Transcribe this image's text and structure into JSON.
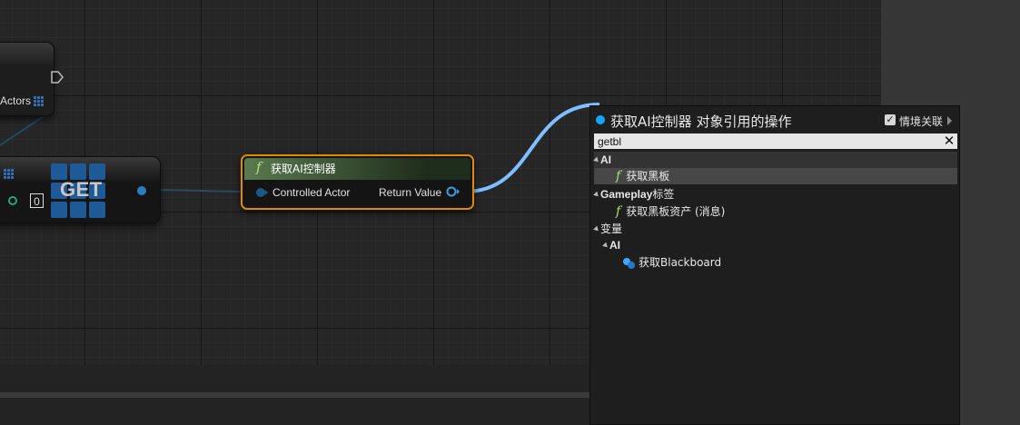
{
  "graph": {
    "top_node": {
      "pin_label": "Actors"
    },
    "get_node": {
      "title": "GET",
      "index_value": "0"
    },
    "ai_node": {
      "title": "获取AI控制器",
      "input_label": "Controlled Actor",
      "output_label": "Return Value",
      "border_color": "#e08a00",
      "header_color": "#5a7a4f"
    },
    "wire_color": "#7fbfff"
  },
  "popup": {
    "title": "获取AI控制器 对象引用的操作",
    "context_label": "情境关联",
    "context_checked": true,
    "search": {
      "value": "getbl"
    },
    "items": [
      {
        "label": "AI"
      },
      {
        "label": "获取黑板"
      },
      {
        "label": "Gameplay",
        "suffix": "标签"
      },
      {
        "label": "获取黑板资产 (消息)"
      },
      {
        "label": "变量"
      },
      {
        "label": "AI"
      },
      {
        "label": "获取Blackboard"
      }
    ]
  },
  "icons": [
    "exec-pin-icon",
    "grid-icon",
    "function-icon",
    "close-icon",
    "checkbox-icon",
    "chevron-right-icon",
    "variable-icon",
    "object-pin-icon"
  ]
}
